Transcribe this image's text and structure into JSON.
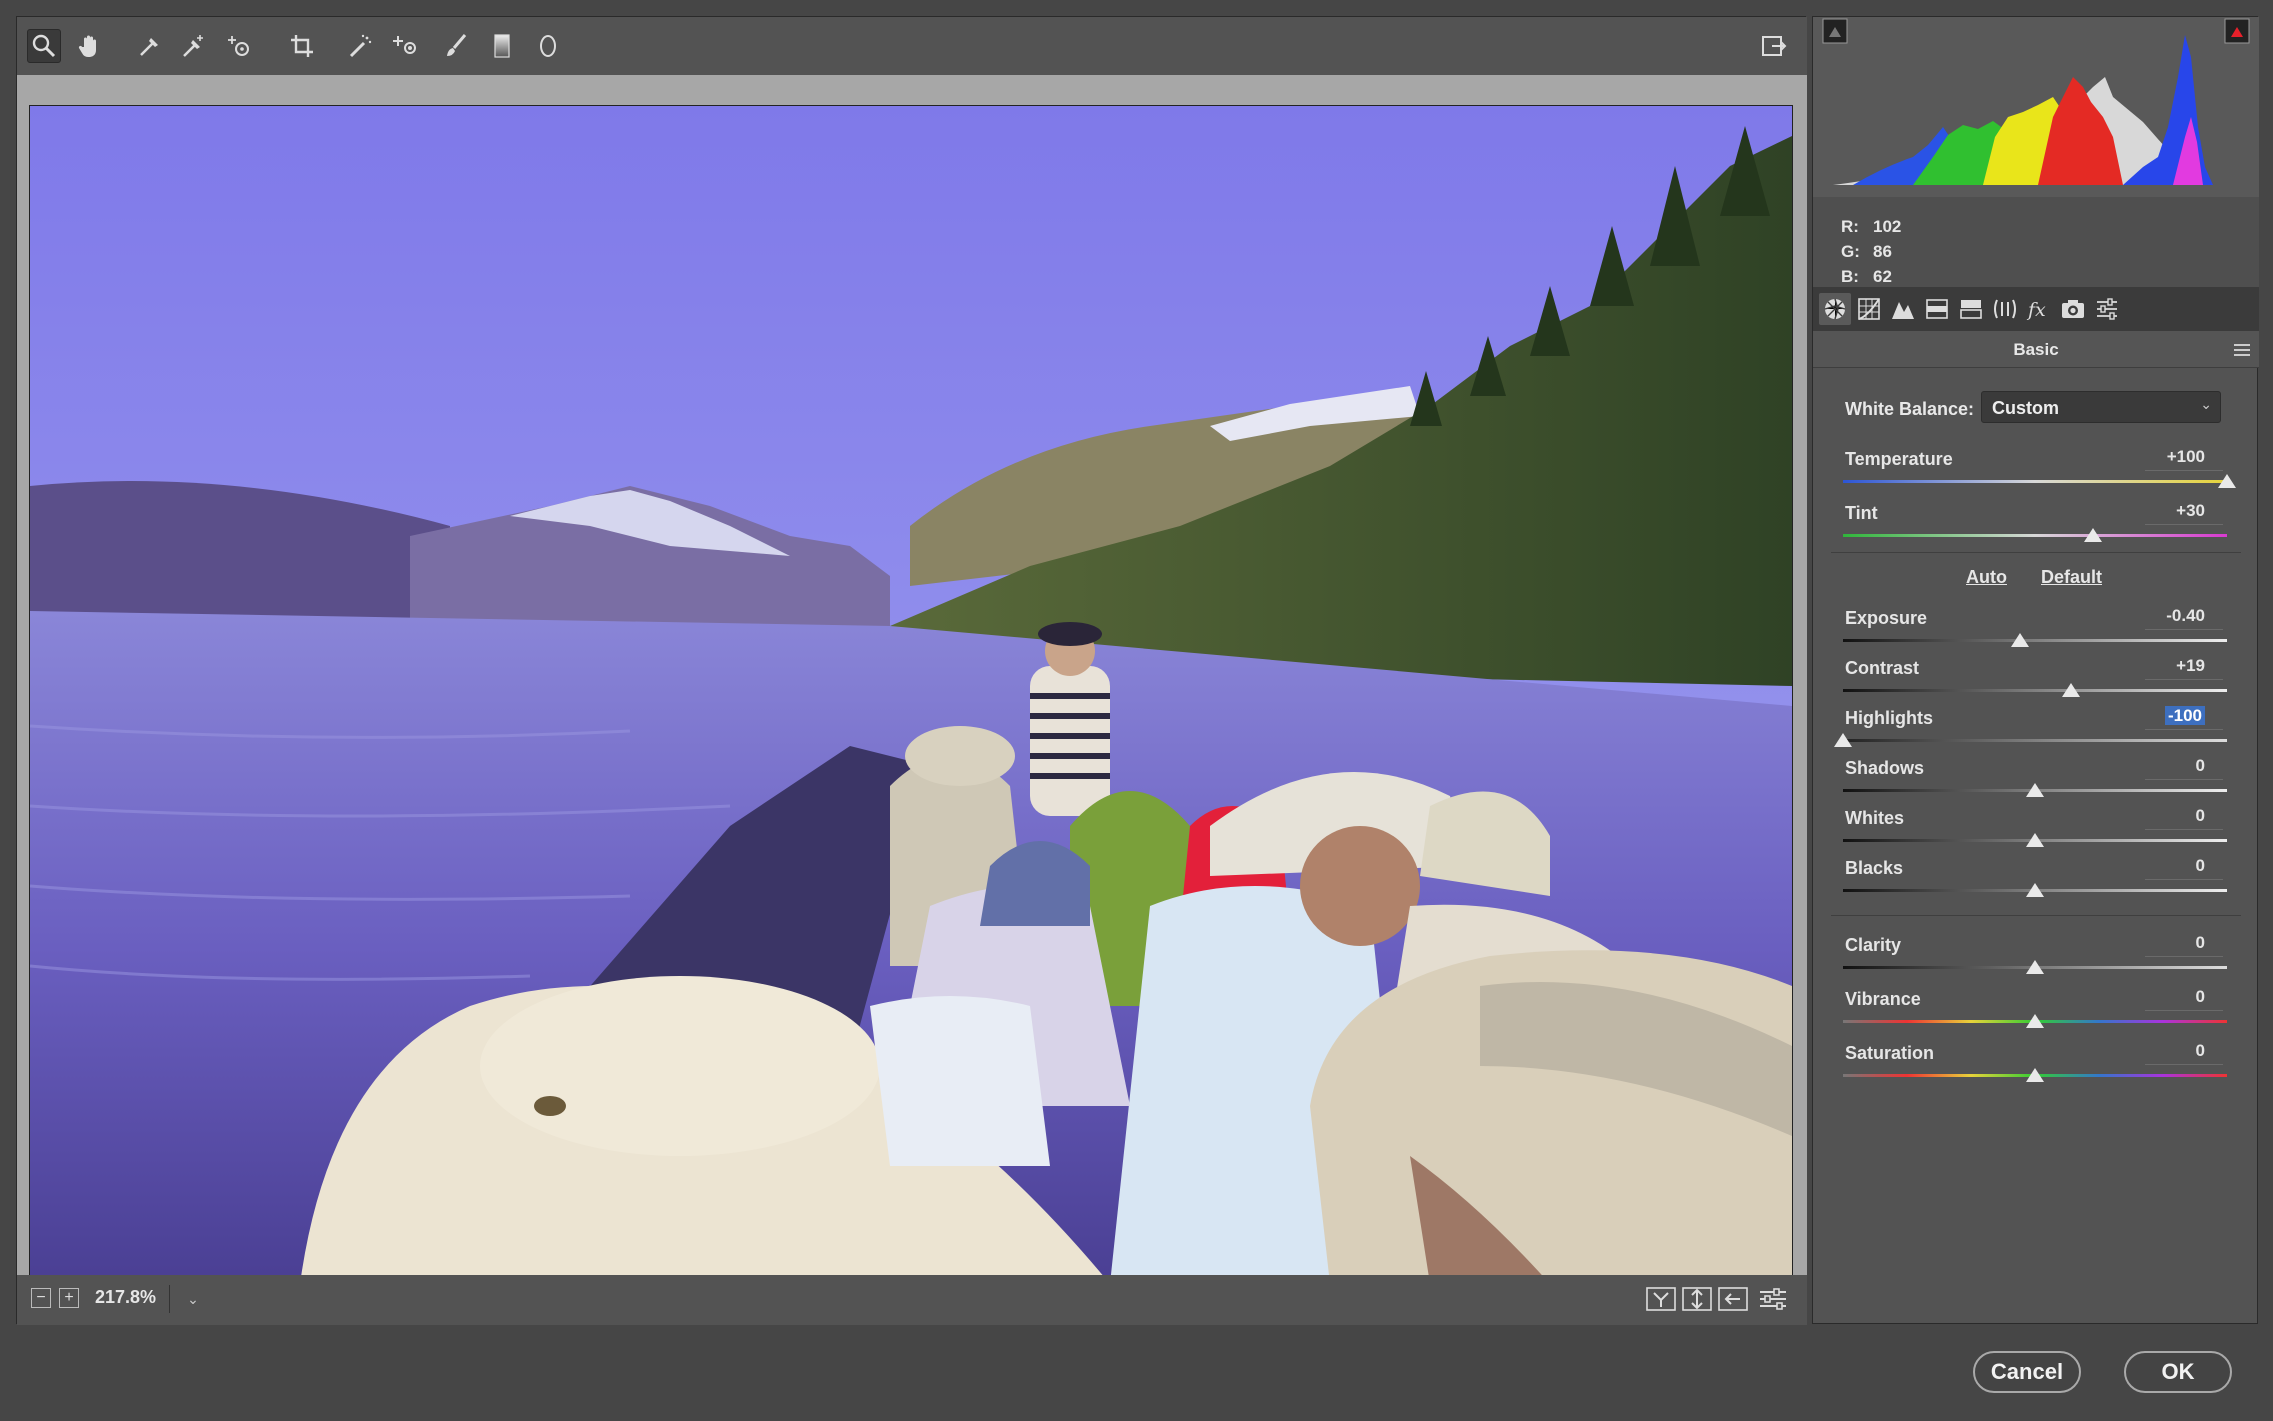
{
  "toolbar": {
    "tools": [
      "zoom-icon",
      "hand-icon",
      "white-balance-icon",
      "color-sampler-icon",
      "targeted-adjustment-icon",
      "crop-icon",
      "spot-removal-icon",
      "red-eye-icon",
      "adjustment-brush-icon",
      "graduated-filter-icon",
      "radial-filter-icon"
    ],
    "open_preferences": "preferences-icon"
  },
  "status": {
    "zoom_out": "−",
    "zoom_in": "+",
    "zoom": "217.8%",
    "zoom_dropdown": "⌄"
  },
  "readout": {
    "r_label": "R:",
    "r": "102",
    "g_label": "G:",
    "g": "86",
    "b_label": "B:",
    "b": "62"
  },
  "panel": {
    "section_title": "Basic",
    "white_balance_label": "White Balance:",
    "white_balance_value": "Custom",
    "auto_label": "Auto",
    "default_label": "Default"
  },
  "sliders": [
    {
      "label": "Temperature",
      "value": "+100",
      "position": 1.0
    },
    {
      "label": "Tint",
      "value": "+30",
      "position": 0.65
    },
    {
      "label": "Exposure",
      "value": "-0.40",
      "position": 0.46
    },
    {
      "label": "Contrast",
      "value": "+19",
      "position": 0.595
    },
    {
      "label": "Highlights",
      "value": "-100",
      "position": 0.0
    },
    {
      "label": "Shadows",
      "value": "0",
      "position": 0.5
    },
    {
      "label": "Whites",
      "value": "0",
      "position": 0.5
    },
    {
      "label": "Blacks",
      "value": "0",
      "position": 0.5
    },
    {
      "label": "Clarity",
      "value": "0",
      "position": 0.5
    },
    {
      "label": "Vibrance",
      "value": "0",
      "position": 0.5
    },
    {
      "label": "Saturation",
      "value": "0",
      "position": 0.5
    }
  ],
  "buttons": {
    "cancel": "Cancel",
    "ok": "OK"
  },
  "colors": {
    "background": "#464646",
    "panel": "#535353",
    "accent_selection": "#3d6fbf"
  }
}
